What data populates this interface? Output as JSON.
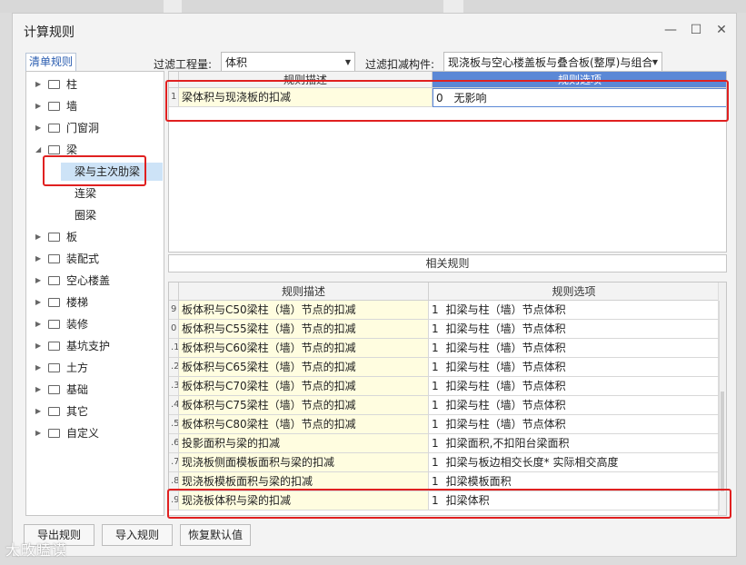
{
  "window": {
    "title": "计算规则",
    "minimize": "—",
    "maximize": "☐",
    "close": "✕"
  },
  "tab": "清单规则",
  "filters": {
    "qty_label": "过滤工程量:",
    "qty_value": "体积",
    "member_label": "过滤扣减构件:",
    "member_value": "现浇板与空心楼盖板与叠合板(整厚)与组合"
  },
  "tree": {
    "items": [
      "柱",
      "墙",
      "门窗洞",
      "梁",
      "板",
      "装配式",
      "空心楼盖",
      "楼梯",
      "装修",
      "基坑支护",
      "土方",
      "基础",
      "其它",
      "自定义"
    ],
    "beam_children": [
      "梁与主次肋梁",
      "连梁",
      "圈梁"
    ]
  },
  "top_table": {
    "headers": [
      "规则描述",
      "规则选项"
    ],
    "rows": [
      {
        "num": "1",
        "desc": "梁体积与现浇板的扣减",
        "opt_code": "0",
        "opt": "无影响"
      }
    ]
  },
  "related_title": "相关规则",
  "bottom_table": {
    "headers": [
      "规则描述",
      "规则选项"
    ],
    "rows": [
      {
        "num": "9",
        "desc": "板体积与C50梁柱（墙）节点的扣减",
        "opt_code": "1",
        "opt": "扣梁与柱（墙）节点体积"
      },
      {
        "num": "0",
        "desc": "板体积与C55梁柱（墙）节点的扣减",
        "opt_code": "1",
        "opt": "扣梁与柱（墙）节点体积"
      },
      {
        "num": ".1",
        "desc": "板体积与C60梁柱（墙）节点的扣减",
        "opt_code": "1",
        "opt": "扣梁与柱（墙）节点体积"
      },
      {
        "num": ".2",
        "desc": "板体积与C65梁柱（墙）节点的扣减",
        "opt_code": "1",
        "opt": "扣梁与柱（墙）节点体积"
      },
      {
        "num": ".3",
        "desc": "板体积与C70梁柱（墙）节点的扣减",
        "opt_code": "1",
        "opt": "扣梁与柱（墙）节点体积"
      },
      {
        "num": ".4",
        "desc": "板体积与C75梁柱（墙）节点的扣减",
        "opt_code": "1",
        "opt": "扣梁与柱（墙）节点体积"
      },
      {
        "num": ".5",
        "desc": "板体积与C80梁柱（墙）节点的扣减",
        "opt_code": "1",
        "opt": "扣梁与柱（墙）节点体积"
      },
      {
        "num": ".6",
        "desc": "投影面积与梁的扣减",
        "opt_code": "1",
        "opt": "扣梁面积,不扣阳台梁面积"
      },
      {
        "num": ".7",
        "desc": "现浇板侧面模板面积与梁的扣减",
        "opt_code": "1",
        "opt": "扣梁与板边相交长度* 实际相交高度"
      },
      {
        "num": ".8",
        "desc": "现浇板模板面积与梁的扣减",
        "opt_code": "1",
        "opt": "扣梁模板面积"
      },
      {
        "num": ".9",
        "desc": "现浇板体积与梁的扣减",
        "opt_code": "1",
        "opt": "扣梁体积"
      }
    ]
  },
  "buttons": {
    "export": "导出规则",
    "import": "导入规则",
    "reset": "恢复默认值"
  },
  "watermark": "大畋瞌谟",
  "colors": {
    "selection": "#cde3f7",
    "highlight": "#e02020",
    "header_active": "#5b88d6",
    "row_fill": "#fffde0"
  }
}
